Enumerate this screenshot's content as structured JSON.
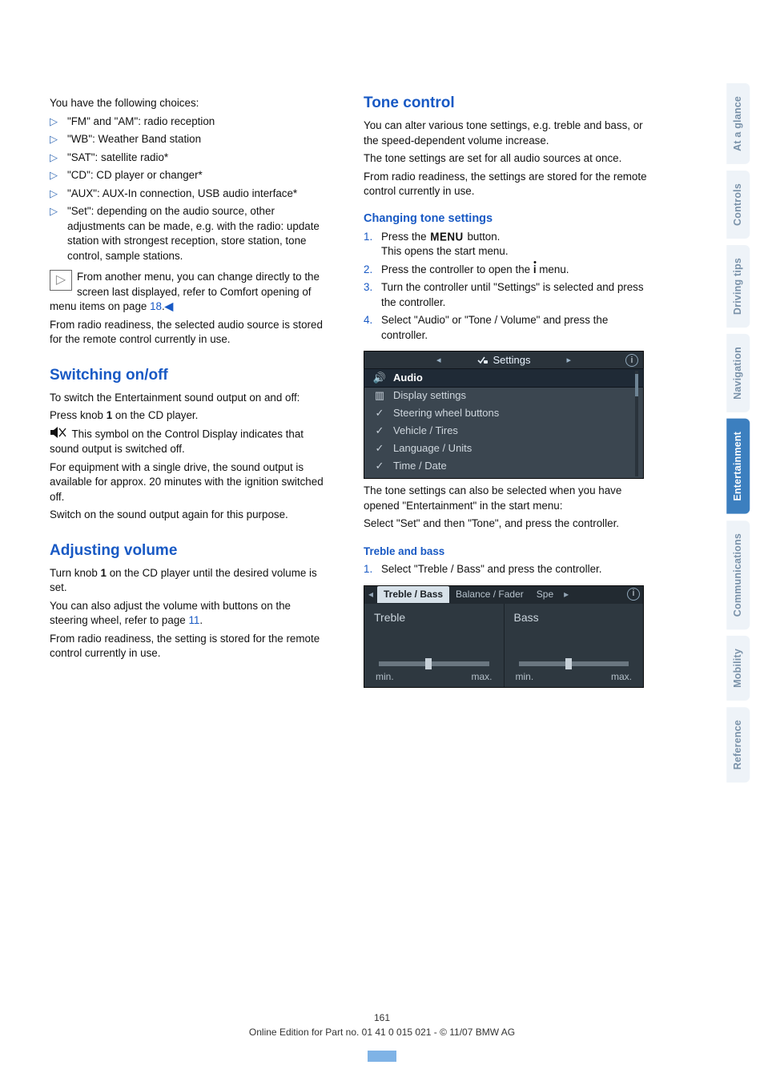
{
  "left": {
    "choices_intro": "You have the following choices:",
    "choices": [
      "\"FM\" and \"AM\": radio reception",
      "\"WB\": Weather Band station",
      "\"SAT\": satellite radio*",
      "\"CD\": CD player or changer*",
      "\"AUX\": AUX-In connection, USB audio interface*",
      "\"Set\": depending on the audio source, other adjustments can be made, e.g. with the radio: update station with strongest reception, store station, tone control, sample stations."
    ],
    "note_text_1": "From another menu, you can change directly to the screen last displayed, refer to Comfort opening of menu items on page ",
    "note_page_ref": "18",
    "note_text_end": ".",
    "radio_readiness": "From radio readiness, the selected audio source is stored for the remote control currently in use.",
    "switch_h": "Switching on/off",
    "switch_p1": "To switch the Entertainment sound output on and off:",
    "switch_p2_a": "Press knob ",
    "switch_knob": "1",
    "switch_p2_b": " on the CD player.",
    "switch_p3": " This symbol on the Control Display indicates that sound output is switched off.",
    "switch_p4": "For equipment with a single drive, the sound output is available for approx. 20 minutes with the ignition switched off.",
    "switch_p5": "Switch on the sound output again for this purpose.",
    "vol_h": "Adjusting volume",
    "vol_p1_a": "Turn knob ",
    "vol_knob": "1",
    "vol_p1_b": " on the CD player until the desired volume is set.",
    "vol_p2_a": "You can also adjust the volume with buttons on the steering wheel, refer to page ",
    "vol_page_ref": "11",
    "vol_p2_b": ".",
    "vol_p3": "From radio readiness, the setting is stored for the remote control currently in use."
  },
  "right": {
    "tone_h": "Tone control",
    "tone_p1": "You can alter various tone settings, e.g. treble and bass, or the speed-dependent volume increase.",
    "tone_p2": "The tone settings are set for all audio sources at once.",
    "tone_p3": "From radio readiness, the settings are stored for the remote control currently in use.",
    "change_h": "Changing tone settings",
    "steps": [
      {
        "a": "Press the ",
        "glyph": "MENU",
        "b": " button.",
        "sub": "This opens the start menu."
      },
      {
        "a": "Press the controller to open the ",
        "glyph": "i",
        "b": " menu."
      },
      {
        "a": "Turn the controller until \"Settings\" is selected and press the controller."
      },
      {
        "a": "Select \"Audio\" or \"Tone / Volume\" and press the controller."
      }
    ],
    "screen1": {
      "title": "Settings",
      "rows": [
        "Audio",
        "Display settings",
        "Steering wheel buttons",
        "Vehicle / Tires",
        "Language / Units",
        "Time / Date"
      ],
      "selected_index": 0
    },
    "after_screen1_a": "The tone settings can also be selected when you have opened \"Entertainment\" in the start menu:",
    "after_screen1_b": "Select \"Set\" and then \"Tone\", and press the controller.",
    "treble_h": "Treble and bass",
    "treble_step": "Select \"Treble / Bass\" and press the controller.",
    "screen2": {
      "tabs": [
        "Treble / Bass",
        "Balance / Fader",
        "Spe"
      ],
      "active_tab": 0,
      "cols": [
        {
          "label": "Treble",
          "min": "min.",
          "max": "max.",
          "pos": 0.45
        },
        {
          "label": "Bass",
          "min": "min.",
          "max": "max.",
          "pos": 0.45
        }
      ]
    }
  },
  "side_tabs": [
    {
      "label": "At a glance",
      "active": false
    },
    {
      "label": "Controls",
      "active": false
    },
    {
      "label": "Driving tips",
      "active": false
    },
    {
      "label": "Navigation",
      "active": false
    },
    {
      "label": "Entertainment",
      "active": true
    },
    {
      "label": "Communications",
      "active": false
    },
    {
      "label": "Mobility",
      "active": false
    },
    {
      "label": "Reference",
      "active": false
    }
  ],
  "footer": {
    "page_num": "161",
    "line": "Online Edition for Part no. 01 41 0 015 021 - © 11/07 BMW AG"
  }
}
